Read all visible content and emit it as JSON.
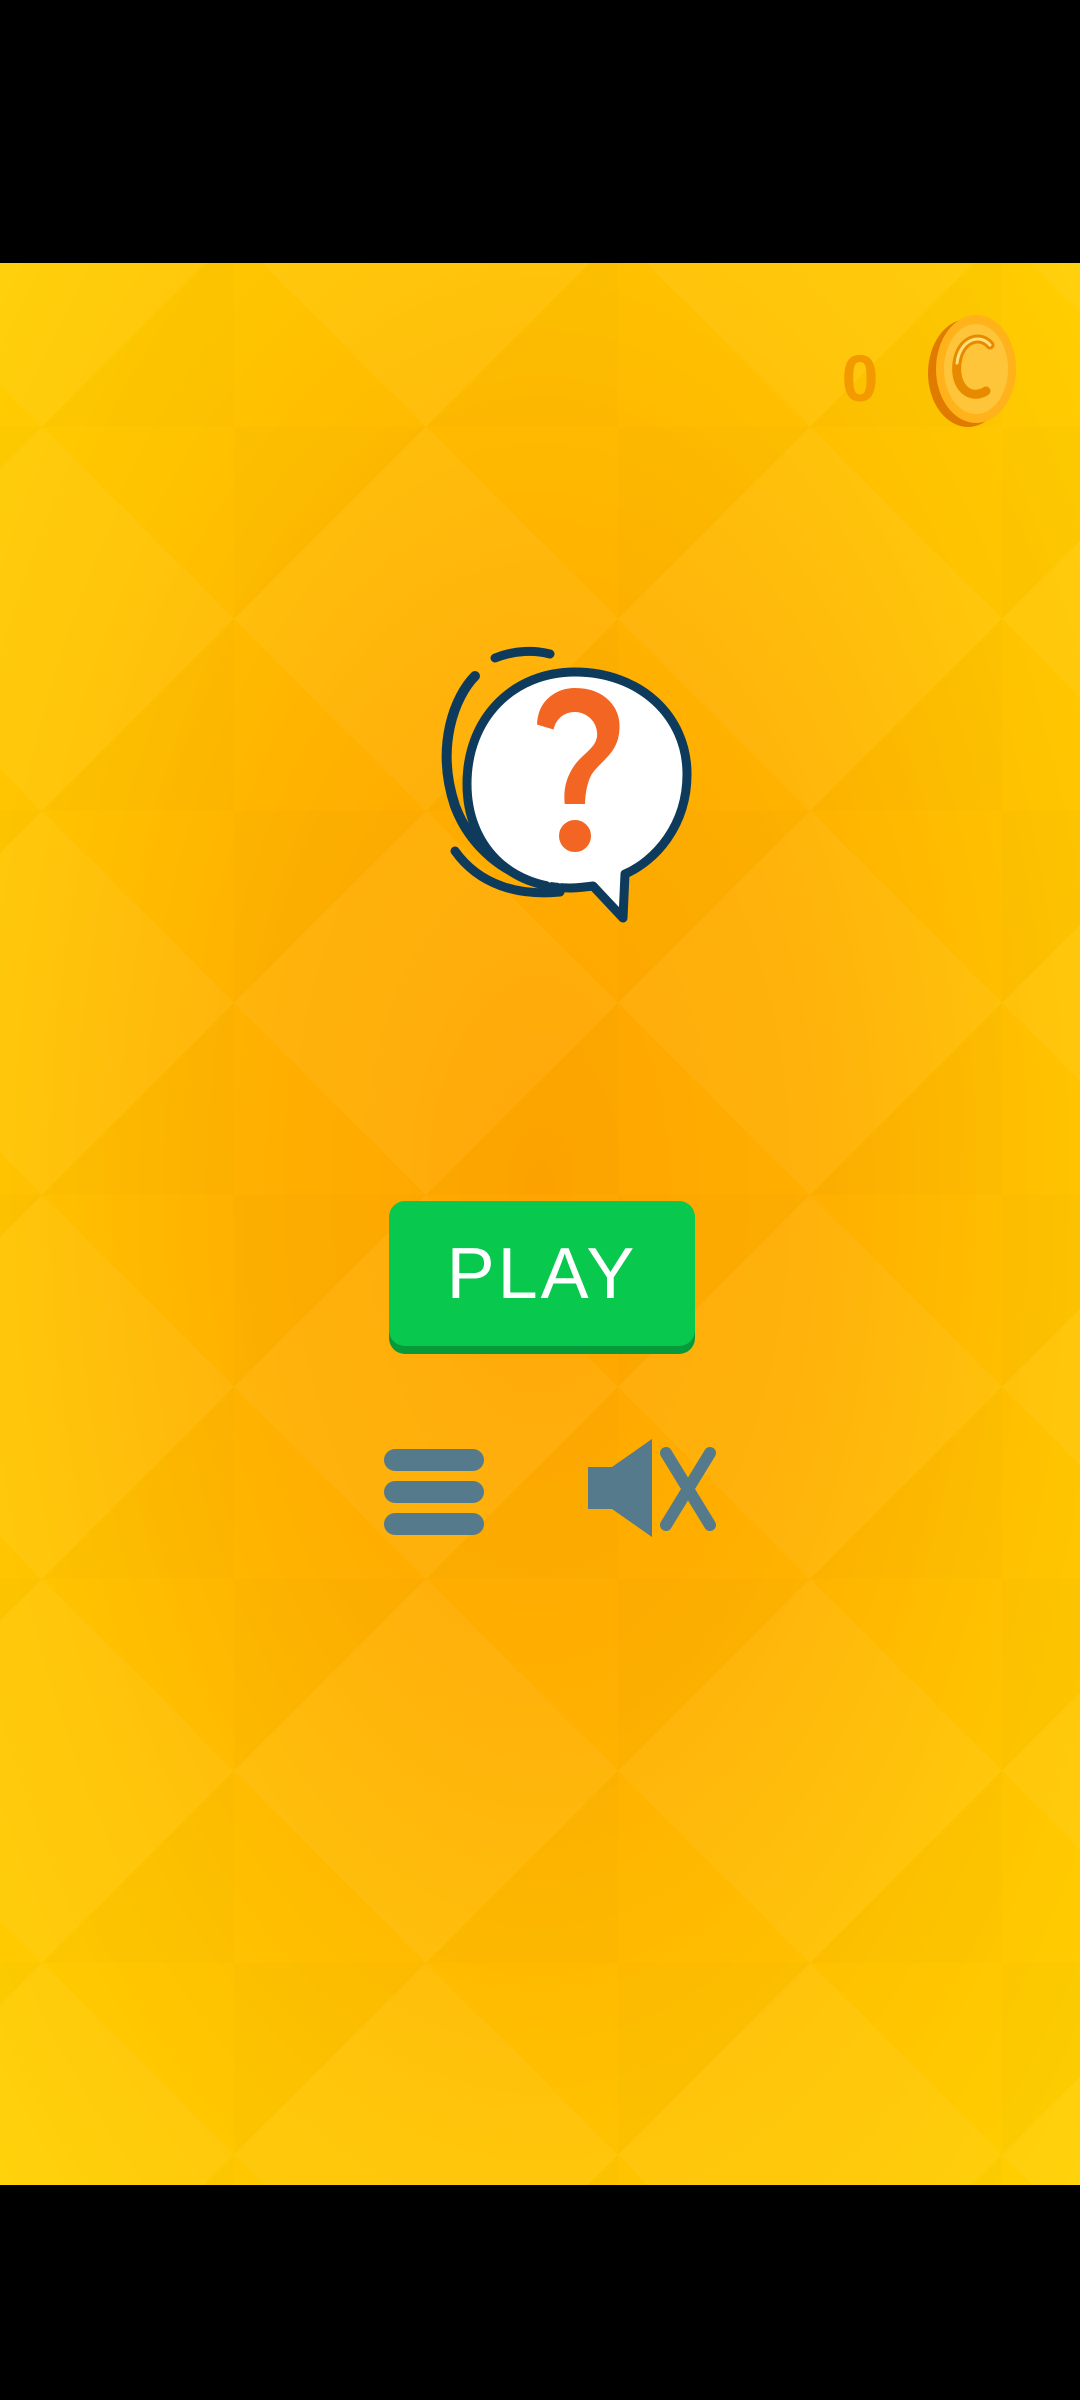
{
  "app": {
    "background_colors": [
      "#FFA400",
      "#FFC300",
      "#FFD000"
    ]
  },
  "coins": {
    "count": "0",
    "icon": "coin-icon",
    "color": "#F29A00"
  },
  "logo": {
    "icon": "question-speech-bubble-icon",
    "question_color": "#F26522"
  },
  "play_button": {
    "label": "PLAY",
    "color": "#08C94E"
  },
  "controls": {
    "menu_icon": "hamburger-menu-icon",
    "sound_icon": "speaker-muted-icon",
    "icon_color": "#557A8C"
  }
}
